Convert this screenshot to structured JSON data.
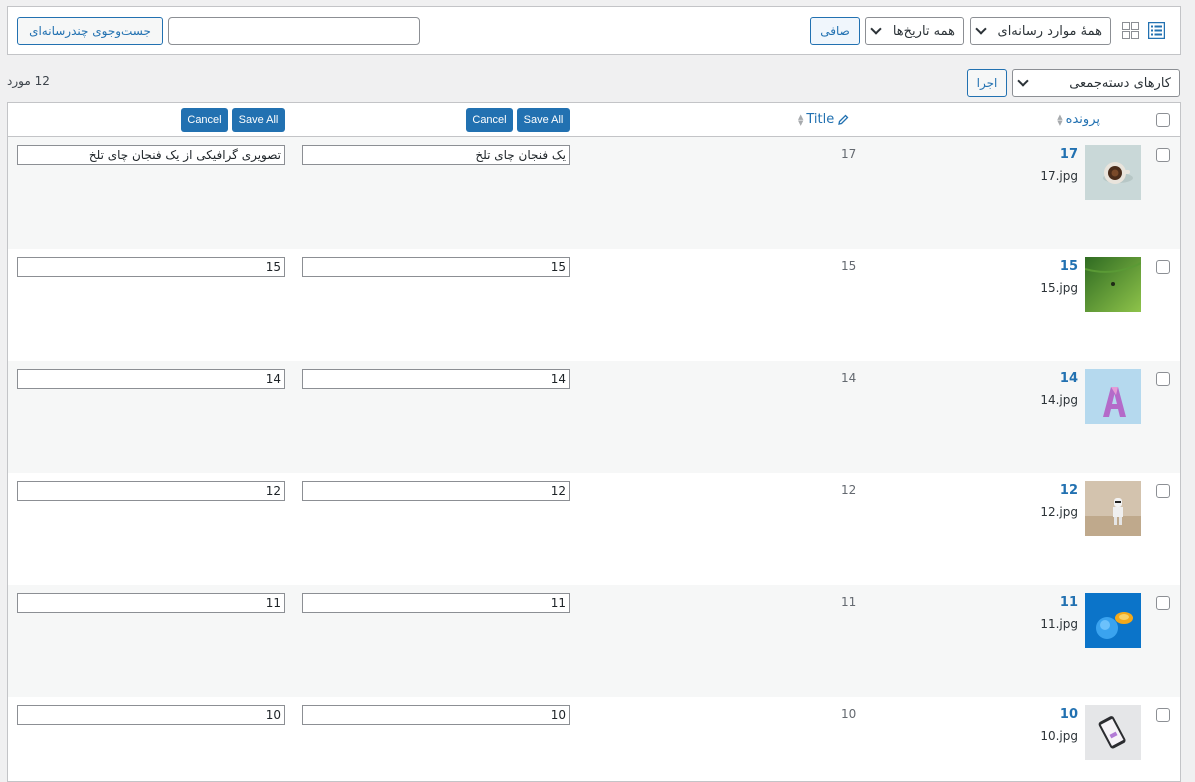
{
  "toolbar": {
    "media_type_select": "همهٔ موارد رسانه‌ای",
    "dates_select": "همه تاریخ‌ها",
    "filter_button": "صافی",
    "search_input_value": "",
    "search_button": "جست‌وجوی چندرسانه‌ای"
  },
  "bulk": {
    "actions_select": "کارهای دسته‌جمعی",
    "apply_button": "اجرا",
    "items_count": "12 مورد"
  },
  "columns": {
    "file": "پرونده",
    "title": "Title",
    "col3_save_all": "Save All",
    "col3_cancel": "Cancel",
    "col4_save_all": "Save All",
    "col4_cancel": "Cancel"
  },
  "rows": [
    {
      "id": "17",
      "filename": "17.jpg",
      "number": "17",
      "title_value": "یک فنجان چای تلخ",
      "alt_value": "تصویری گرافیکی از یک فنجان چای تلخ",
      "thumb": "coffee-cup"
    },
    {
      "id": "15",
      "filename": "15.jpg",
      "number": "15",
      "title_value": "15",
      "alt_value": "15",
      "thumb": "green-field"
    },
    {
      "id": "14",
      "filename": "14.jpg",
      "number": "14",
      "title_value": "14",
      "alt_value": "14",
      "thumb": "letter-a"
    },
    {
      "id": "12",
      "filename": "12.jpg",
      "number": "12",
      "title_value": "12",
      "alt_value": "12",
      "thumb": "stormtrooper"
    },
    {
      "id": "11",
      "filename": "11.jpg",
      "number": "11",
      "title_value": "11",
      "alt_value": "11",
      "thumb": "blue-ball"
    },
    {
      "id": "10",
      "filename": "10.jpg",
      "number": "10",
      "title_value": "10",
      "alt_value": "10",
      "thumb": "phone"
    }
  ],
  "colors": {
    "link": "#2271b1",
    "border": "#c3c4c7",
    "background": "#f0f0f1"
  }
}
